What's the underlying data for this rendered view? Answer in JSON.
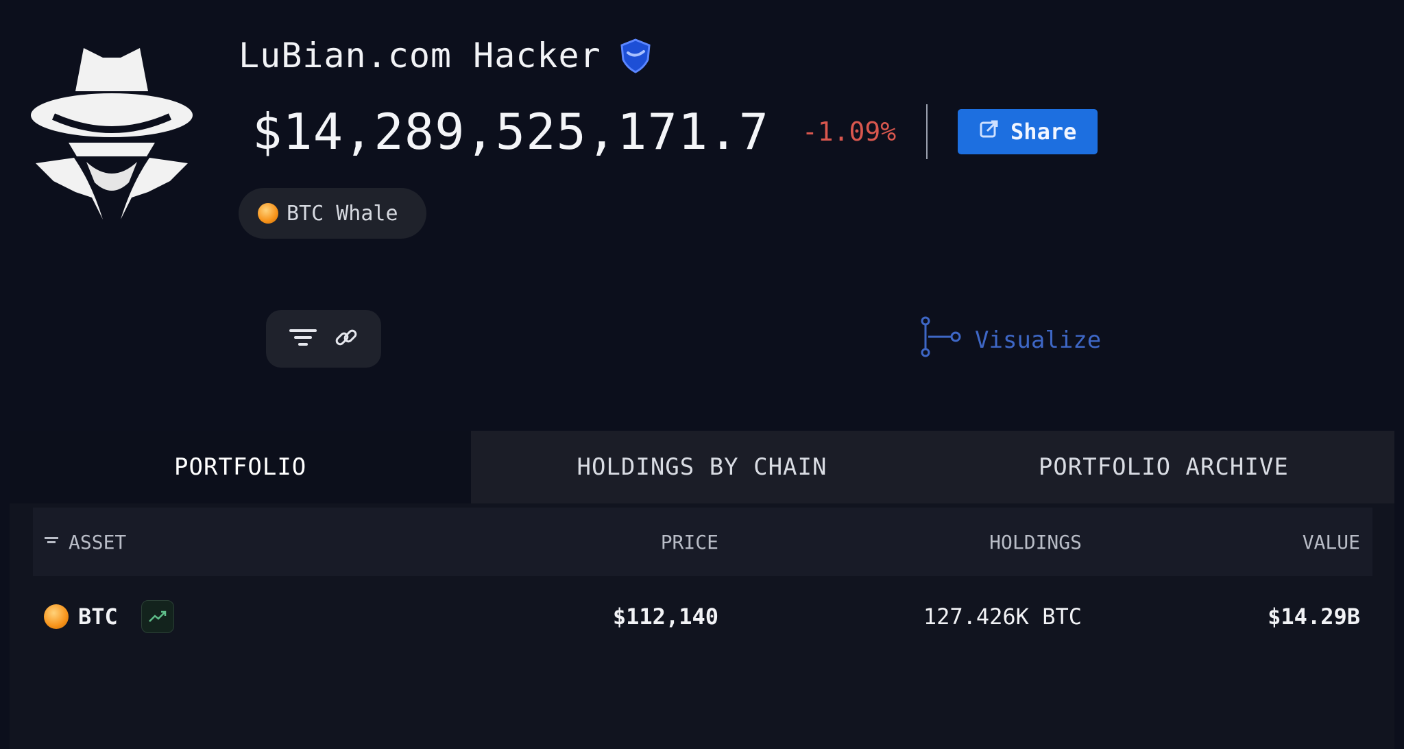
{
  "profile": {
    "name": "LuBian.com Hacker",
    "avatar_icon": "spy-hat-icon",
    "net_worth": "$14,289,525,171.7",
    "change_pct": "-1.09%",
    "share_label": "Share",
    "badge_label": "BTC Whale"
  },
  "toolbar": {
    "filter_icon": "filter-icon",
    "link_icon": "link-icon",
    "visualize_label": "Visualize"
  },
  "tabs": [
    {
      "label": "PORTFOLIO",
      "active": true
    },
    {
      "label": "HOLDINGS BY CHAIN",
      "active": false
    },
    {
      "label": "PORTFOLIO ARCHIVE",
      "active": false
    }
  ],
  "table": {
    "columns": {
      "asset": "ASSET",
      "price": "PRICE",
      "holdings": "HOLDINGS",
      "value": "VALUE"
    },
    "rows": [
      {
        "asset": "BTC",
        "price": "$112,140",
        "holdings": "127.426K BTC",
        "value": "$14.29B"
      }
    ]
  },
  "colors": {
    "background": "#0c0f1c",
    "accent": "#1d6fe0",
    "negative": "#d9574e",
    "btc": "#f7931a"
  }
}
